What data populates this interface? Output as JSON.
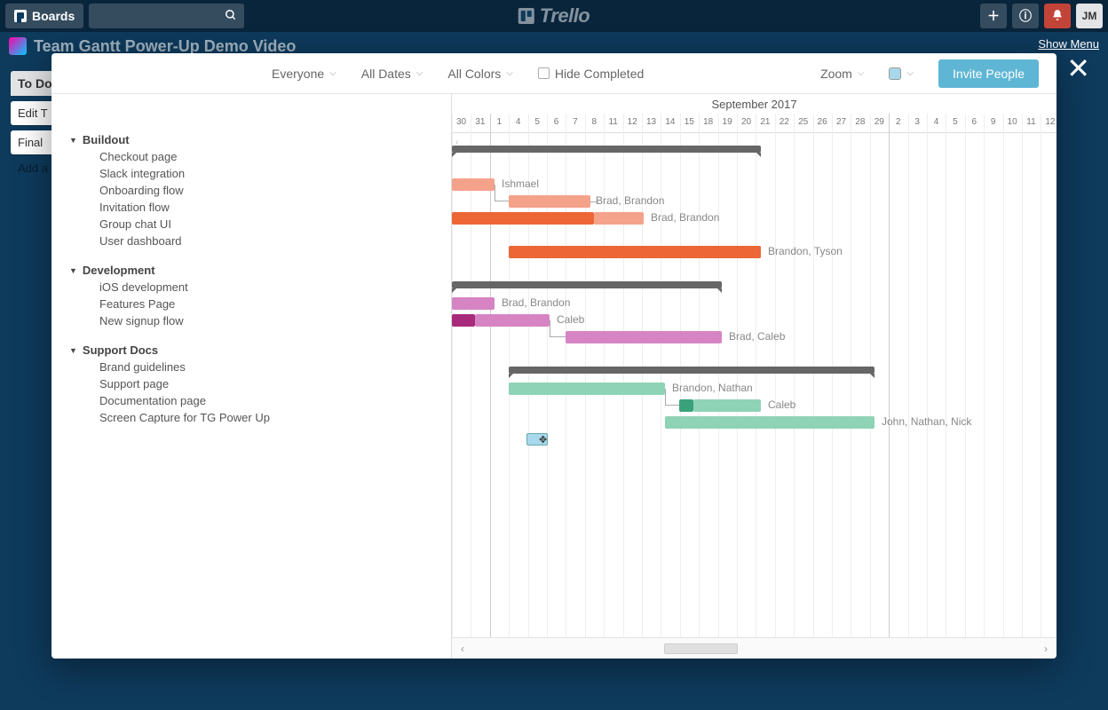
{
  "header": {
    "boards_btn": "Boards",
    "logo_text": "Trello",
    "user_initials": "JM"
  },
  "board": {
    "title": "Team Gantt Power-Up Demo Video",
    "show_menu": "Show Menu",
    "bg_list_title": "To Do",
    "bg_card1": "Edit T",
    "bg_card2": "Final",
    "bg_add": "Add a"
  },
  "toolbar": {
    "everyone": "Everyone",
    "all_dates": "All Dates",
    "all_colors": "All Colors",
    "hide_completed": "Hide Completed",
    "zoom": "Zoom",
    "invite": "Invite People"
  },
  "timeline": {
    "month": "September 2017",
    "days": [
      "30",
      "31",
      "1",
      "4",
      "5",
      "6",
      "7",
      "8",
      "11",
      "12",
      "13",
      "14",
      "15",
      "18",
      "19",
      "20",
      "21",
      "22",
      "25",
      "26",
      "27",
      "28",
      "29",
      "2",
      "3",
      "4",
      "5",
      "6",
      "9",
      "10",
      "11",
      "12"
    ]
  },
  "groups": [
    {
      "name": "Buildout",
      "tasks": [
        {
          "name": "Checkout page"
        },
        {
          "name": "Slack integration",
          "label": "Ishmael"
        },
        {
          "name": "Onboarding flow",
          "label": "Brad, Brandon"
        },
        {
          "name": "Invitation flow",
          "label": "Brad, Brandon"
        },
        {
          "name": "Group chat UI"
        },
        {
          "name": "User dashboard",
          "label": "Brandon, Tyson"
        }
      ]
    },
    {
      "name": "Development",
      "tasks": [
        {
          "name": "iOS development",
          "label": "Brad, Brandon"
        },
        {
          "name": "Features Page",
          "label": "Caleb"
        },
        {
          "name": "New signup flow",
          "label": "Brad, Caleb"
        }
      ]
    },
    {
      "name": "Support Docs",
      "tasks": [
        {
          "name": "Brand guidelines",
          "label": "Brandon, Nathan"
        },
        {
          "name": "Support page",
          "label": "Caleb"
        },
        {
          "name": "Documentation page",
          "label": "John, Nathan, Nick"
        },
        {
          "name": "Screen Capture for TG Power Up"
        }
      ]
    }
  ]
}
